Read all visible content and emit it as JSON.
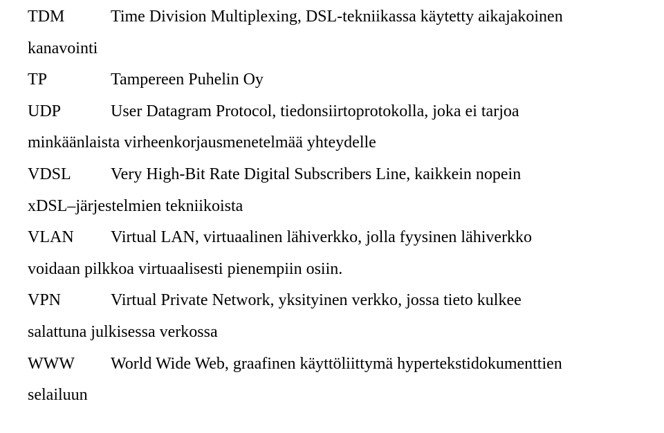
{
  "entries": {
    "tdm": {
      "abbr": "TDM",
      "def": "Time Division Multiplexing, DSL-tekniikassa käytetty aikajakoinen",
      "cont": "kanavointi"
    },
    "tp": {
      "abbr": "TP",
      "def": "Tampereen Puhelin Oy"
    },
    "udp": {
      "abbr": "UDP",
      "def": "User Datagram Protocol, tiedonsiirtoprotokolla, joka ei tarjoa",
      "cont": "minkäänlaista virheenkorjausmenetelmää yhteydelle"
    },
    "vdsl": {
      "abbr": "VDSL",
      "def": "Very High-Bit Rate Digital Subscribers Line, kaikkein nopein",
      "cont": "xDSL–järjestelmien tekniikoista"
    },
    "vlan": {
      "abbr": "VLAN",
      "def": "Virtual LAN, virtuaalinen lähiverkko, jolla fyysinen lähiverkko",
      "cont": "voidaan pilkkoa virtuaalisesti pienempiin osiin."
    },
    "vpn": {
      "abbr": "VPN",
      "def": "Virtual Private Network, yksityinen verkko, jossa tieto kulkee",
      "cont": "salattuna julkisessa verkossa"
    },
    "www": {
      "abbr": "WWW",
      "def": "World Wide Web, graafinen käyttöliittymä hypertekstidokumenttien",
      "cont": "selailuun"
    }
  }
}
